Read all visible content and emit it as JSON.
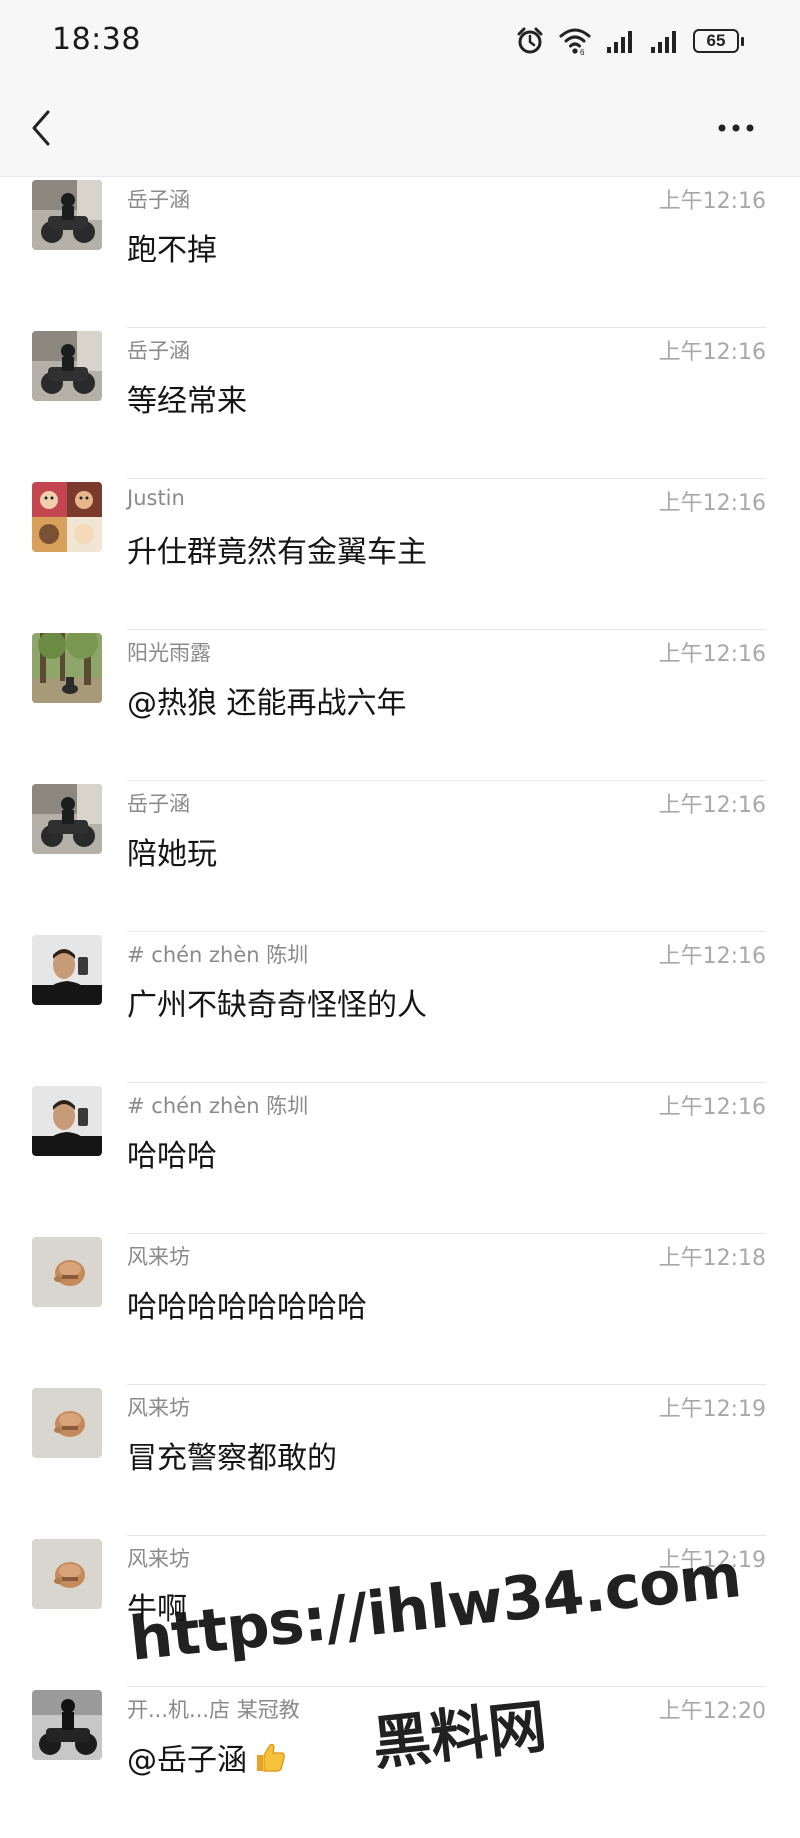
{
  "status_bar": {
    "time": "18:38",
    "battery": "65",
    "icons": [
      "alarm-icon",
      "wifi-icon",
      "signal-icon",
      "signal-icon"
    ]
  },
  "nav": {
    "back_icon": "chevron-left-icon",
    "more_icon": "more-dots-icon"
  },
  "messages": [
    {
      "sender": "岳子涵",
      "time": "上午12:16",
      "text": "跑不掉",
      "avatar": "motorcycle"
    },
    {
      "sender": "岳子涵",
      "time": "上午12:16",
      "text": "等经常来",
      "avatar": "motorcycle"
    },
    {
      "sender": "Justin",
      "time": "上午12:16",
      "text": "升仕群竟然有金翼车主",
      "avatar": "anime"
    },
    {
      "sender": "阳光雨露",
      "time": "上午12:16",
      "text": "@热狼 还能再战六年",
      "avatar": "forest"
    },
    {
      "sender": "岳子涵",
      "time": "上午12:16",
      "text": "陪她玩",
      "avatar": "motorcycle"
    },
    {
      "sender": "# chén zhèn   陈圳",
      "time": "上午12:16",
      "text": "广州不缺奇奇怪怪的人",
      "avatar": "selfie"
    },
    {
      "sender": "# chén zhèn   陈圳",
      "time": "上午12:16",
      "text": "哈哈哈",
      "avatar": "selfie"
    },
    {
      "sender": "风来坊",
      "time": "上午12:18",
      "text": "哈哈哈哈哈哈哈哈",
      "avatar": "helmet"
    },
    {
      "sender": "风来坊",
      "time": "上午12:19",
      "text": "冒充警察都敢的",
      "avatar": "helmet"
    },
    {
      "sender": "风来坊",
      "time": "上午12:19",
      "text": "牛啊",
      "avatar": "helmet"
    },
    {
      "sender": "开...机...店 某冠教",
      "time": "上午12:20",
      "text": "@岳子涵",
      "avatar": "rider",
      "emoji": "thumbs-up"
    }
  ],
  "watermark": {
    "url": "https://ihlw34.com",
    "name": "黑料网"
  }
}
